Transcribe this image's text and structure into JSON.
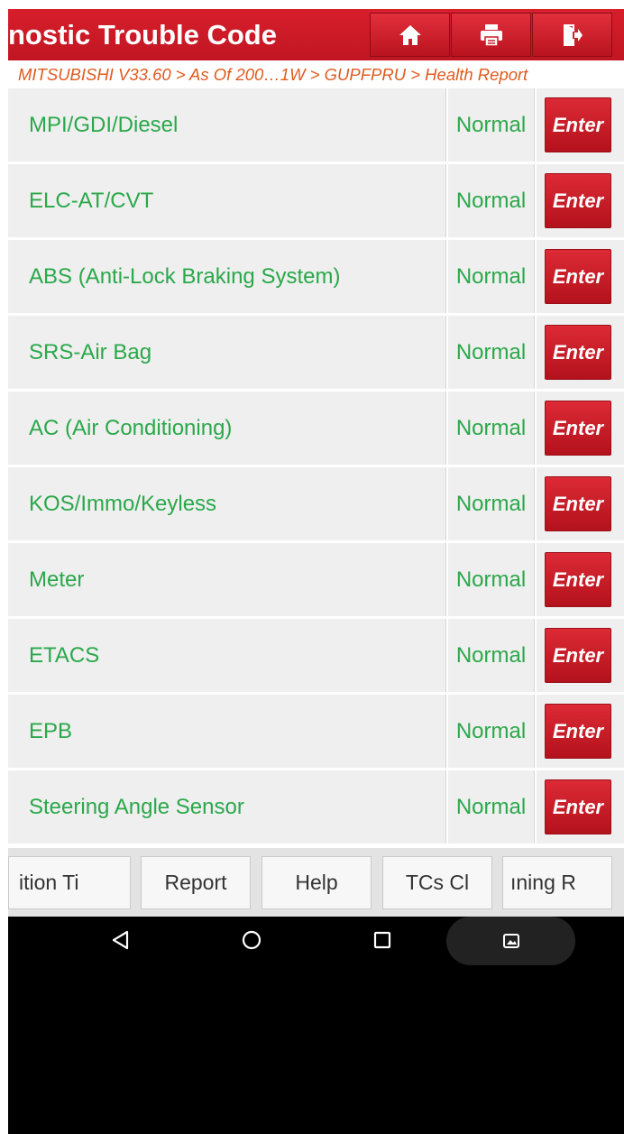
{
  "header": {
    "title": "nostic Trouble Code",
    "buttons": [
      {
        "name": "home-icon"
      },
      {
        "name": "print-icon"
      },
      {
        "name": "exit-icon"
      }
    ]
  },
  "breadcrumb": "MITSUBISHI V33.60 > As Of 200…1W > GUPFPRU > Health Report",
  "rows": [
    {
      "name": "MPI/GDI/Diesel",
      "status": "Normal",
      "action": "Enter"
    },
    {
      "name": "ELC-AT/CVT",
      "status": "Normal",
      "action": "Enter"
    },
    {
      "name": "ABS (Anti-Lock Braking System)",
      "status": "Normal",
      "action": "Enter"
    },
    {
      "name": "SRS-Air Bag",
      "status": "Normal",
      "action": "Enter"
    },
    {
      "name": "AC (Air Conditioning)",
      "status": "Normal",
      "action": "Enter"
    },
    {
      "name": "KOS/Immo/Keyless",
      "status": "Normal",
      "action": "Enter"
    },
    {
      "name": "Meter",
      "status": "Normal",
      "action": "Enter"
    },
    {
      "name": "ETACS",
      "status": "Normal",
      "action": "Enter"
    },
    {
      "name": "EPB",
      "status": "Normal",
      "action": "Enter"
    },
    {
      "name": "Steering Angle Sensor",
      "status": "Normal",
      "action": "Enter"
    }
  ],
  "toolbar": {
    "btn1": "ition   Ti",
    "btn2": "Report",
    "btn3": "Help",
    "btn4": "TCs   Cl",
    "btn5": "ıning    R"
  },
  "colors": {
    "accent": "#c81a26",
    "status_text": "#2aa84a",
    "breadcrumb_text": "#e05a1e"
  }
}
